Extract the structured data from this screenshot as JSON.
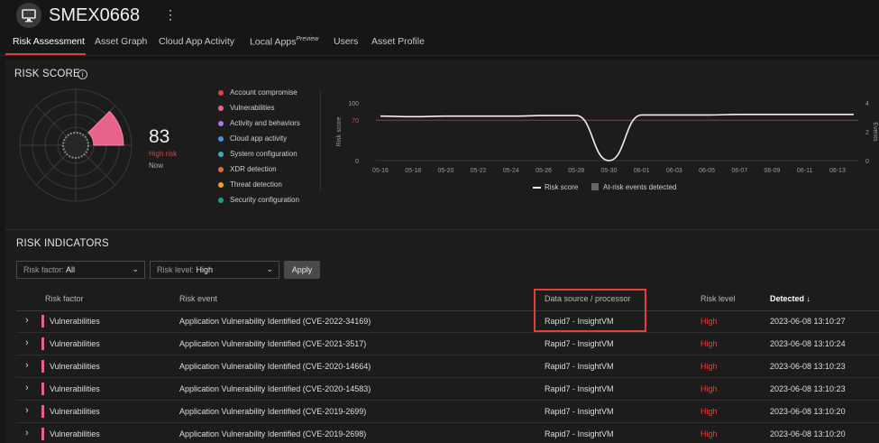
{
  "header": {
    "title": "SMEX0668"
  },
  "tabs": [
    {
      "label": "Risk Assessment",
      "active": true
    },
    {
      "label": "Asset Graph"
    },
    {
      "label": "Cloud App Activity"
    },
    {
      "label": "Local Apps",
      "badge": "Preview"
    },
    {
      "label": "Users"
    },
    {
      "label": "Asset Profile"
    }
  ],
  "risk_score": {
    "title": "RISK SCORE",
    "value": "83",
    "level": "High risk",
    "when": "Now",
    "categories": [
      {
        "label": "Account compromise",
        "color": "#e0413a"
      },
      {
        "label": "Vulnerabilities",
        "color": "#e8638c"
      },
      {
        "label": "Activity and behaviors",
        "color": "#a974e6"
      },
      {
        "label": "Cloud app activity",
        "color": "#4a90d9"
      },
      {
        "label": "System configuration",
        "color": "#2fb3c4"
      },
      {
        "label": "XDR detection",
        "color": "#ea6a3a"
      },
      {
        "label": "Threat detection",
        "color": "#f0a020"
      },
      {
        "label": "Security configuration",
        "color": "#1f9e8e"
      }
    ]
  },
  "chart_data": {
    "type": "line",
    "ylabel": "Risk score",
    "y2label": "Events",
    "yticks": [
      0,
      70,
      100
    ],
    "y2ticks": [
      0,
      2,
      4
    ],
    "ylim": [
      0,
      100
    ],
    "threshold": 70,
    "categories": [
      "05-16",
      "05-18",
      "05-20",
      "05-22",
      "05-24",
      "05-26",
      "05-28",
      "05-30",
      "06-01",
      "06-03",
      "06-05",
      "06-07",
      "06-09",
      "06-11",
      "06-13"
    ],
    "series": [
      {
        "name": "Risk score",
        "color": "#f0f0f0",
        "values": [
          77,
          76,
          77,
          77,
          77,
          78,
          78,
          0,
          79,
          79,
          79,
          80,
          80,
          80,
          80
        ]
      },
      {
        "name": "At-risk events detected",
        "color": "#666666",
        "values": []
      }
    ]
  },
  "indicators": {
    "title": "RISK INDICATORS",
    "filter_factor": {
      "label": "Risk factor:",
      "value": "All"
    },
    "filter_level": {
      "label": "Risk level:",
      "value": "High"
    },
    "apply_label": "Apply",
    "columns": [
      "Risk factor",
      "Risk event",
      "Data source / processor",
      "Risk level",
      "Detected ↓"
    ],
    "rows": [
      {
        "factor": "Vulnerabilities",
        "event": "Application Vulnerability Identified (CVE-2022-34169)",
        "source": "Rapid7 - InsightVM",
        "level": "High",
        "detected": "2023-06-08 13:10:27"
      },
      {
        "factor": "Vulnerabilities",
        "event": "Application Vulnerability Identified (CVE-2021-3517)",
        "source": "Rapid7 - InsightVM",
        "level": "High",
        "detected": "2023-06-08 13:10:24"
      },
      {
        "factor": "Vulnerabilities",
        "event": "Application Vulnerability Identified (CVE-2020-14664)",
        "source": "Rapid7 - InsightVM",
        "level": "High",
        "detected": "2023-06-08 13:10:23"
      },
      {
        "factor": "Vulnerabilities",
        "event": "Application Vulnerability Identified (CVE-2020-14583)",
        "source": "Rapid7 - InsightVM",
        "level": "High",
        "detected": "2023-06-08 13:10:23"
      },
      {
        "factor": "Vulnerabilities",
        "event": "Application Vulnerability Identified (CVE-2019-2699)",
        "source": "Rapid7 - InsightVM",
        "level": "High",
        "detected": "2023-06-08 13:10:20"
      },
      {
        "factor": "Vulnerabilities",
        "event": "Application Vulnerability Identified (CVE-2019-2698)",
        "source": "Rapid7 - InsightVM",
        "level": "High",
        "detected": "2023-06-08 13:10:20"
      }
    ]
  }
}
